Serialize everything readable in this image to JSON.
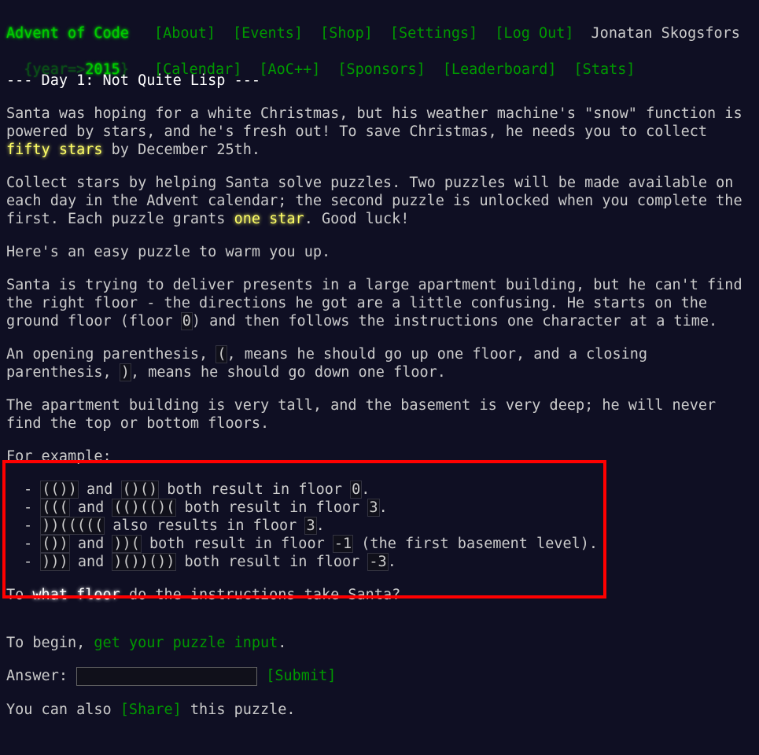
{
  "header": {
    "title": "Advent of Code",
    "year_prefix": "{year=>",
    "year": "2015",
    "year_suffix": "}",
    "nav1": [
      "[About]",
      "[Events]",
      "[Shop]",
      "[Settings]",
      "[Log Out]"
    ],
    "user": "Jonatan Skogsfors",
    "nav2": [
      "[Calendar]",
      "[AoC++]",
      "[Sponsors]",
      "[Leaderboard]",
      "[Stats]"
    ]
  },
  "article": {
    "title": "--- Day 1: Not Quite Lisp ---",
    "p1": [
      "Santa was hoping for a white Christmas, but his weather machine's \"snow\" function is powered by stars, and he's fresh out! To save Christmas, he needs you to collect ",
      "fifty stars",
      " by December 25th."
    ],
    "p2": [
      "Collect stars by helping Santa solve puzzles. Two puzzles will be made available on each day in the Advent calendar; the second puzzle is unlocked when you complete the first. Each puzzle grants ",
      "one star",
      ". Good luck!"
    ],
    "p3": "Here's an easy puzzle to warm you up.",
    "p4": [
      "Santa is trying to deliver presents in a large apartment building, but he can't find the right floor - the directions he got are a little confusing. He starts on the ground floor (floor ",
      "0",
      ") and then follows the instructions one character at a time."
    ],
    "p5": [
      "An opening parenthesis, ",
      "(",
      ", means he should go up one floor, and a closing parenthesis, ",
      ")",
      ", means he should go down one floor."
    ],
    "p6": "The apartment building is very tall, and the basement is very deep; he will never find the top or bottom floors.",
    "example_intro": "For example:",
    "examples": [
      [
        "(())",
        " and ",
        "()()",
        " both result in floor ",
        "0",
        "."
      ],
      [
        "(((",
        " and ",
        "(()(()(",
        " both result in floor ",
        "3",
        "."
      ],
      [
        "))(((((",
        " also results in floor ",
        "3",
        "."
      ],
      [
        "())",
        " and ",
        "))(",
        " both result in floor ",
        "-1",
        " (the first basement level)."
      ],
      [
        ")))",
        " and ",
        ")())())",
        " both result in floor ",
        "-3",
        "."
      ]
    ],
    "question": [
      "To ",
      "what floor",
      " do the instructions take Santa?"
    ]
  },
  "begin": [
    "To begin, ",
    "get your puzzle input",
    "."
  ],
  "answer": {
    "label": "Answer: ",
    "value": "",
    "submit": "[Submit]"
  },
  "share": [
    "You can also ",
    "[Share]",
    " this puzzle."
  ]
}
